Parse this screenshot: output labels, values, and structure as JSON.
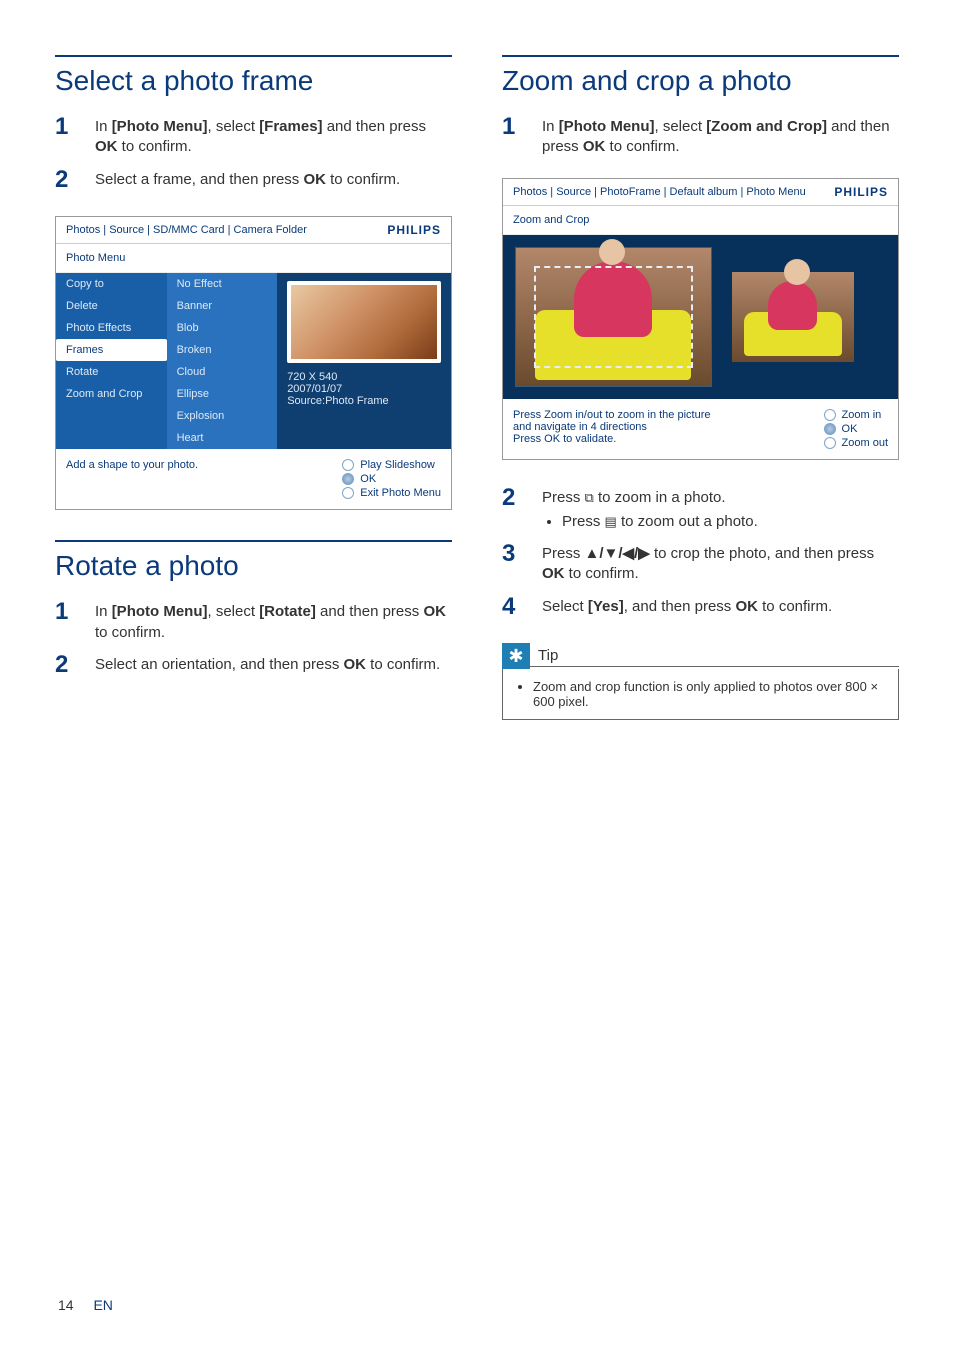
{
  "left": {
    "sec1": {
      "title": "Select a photo frame",
      "steps": [
        "In [Photo Menu], select [Frames] and then press OK to confirm.",
        "Select a frame, and then press OK to confirm."
      ],
      "shot": {
        "breadcrumb": "Photos | Source | SD/MMC Card | Camera Folder",
        "brand": "PHILIPS",
        "subtitle": "Photo Menu",
        "col1": [
          "Copy to",
          "Delete",
          "Photo Effects",
          "Frames",
          "Rotate",
          "Zoom and Crop"
        ],
        "col1_sel": 3,
        "col2": [
          "No Effect",
          "Banner",
          "Blob",
          "Broken",
          "Cloud",
          "Ellipse",
          "Explosion",
          "Heart"
        ],
        "meta": [
          "720 X 540",
          "2007/01/07",
          "Source:Photo Frame"
        ],
        "foot_left": "Add a shape to your photo.",
        "foot_opts": [
          "Play Slideshow",
          "OK",
          "Exit Photo Menu"
        ],
        "foot_sel": 1
      }
    },
    "sec2": {
      "title": "Rotate a photo",
      "steps": [
        "In [Photo Menu], select [Rotate] and then press OK to confirm.",
        "Select an orientation, and then press OK to confirm."
      ]
    }
  },
  "right": {
    "sec1": {
      "title": "Zoom and crop a photo",
      "steps_before": [
        "In [Photo Menu], select [Zoom and Crop] and then press OK to confirm."
      ],
      "shot": {
        "breadcrumb": "Photos | Source | PhotoFrame | Default album | Photo Menu",
        "brand": "PHILIPS",
        "subtitle": "Zoom and Crop",
        "foot_left_lines": [
          "Press Zoom in/out to zoom in the picture",
          "and navigate in 4 directions",
          "Press OK to validate."
        ],
        "foot_opts": [
          "Zoom in",
          "OK",
          "Zoom out"
        ],
        "foot_sel": 1
      },
      "steps_after": [
        {
          "n": "2",
          "t": "Press ⧉ to zoom in a photo.",
          "sub": [
            "Press ▤ to zoom out a photo."
          ]
        },
        {
          "n": "3",
          "t": "Press ▲/▼/◀/▶ to crop the photo, and then press OK to confirm."
        },
        {
          "n": "4",
          "t": "Select [Yes], and then press OK to confirm."
        }
      ],
      "tip": {
        "label": "Tip",
        "text": "Zoom and crop function is only applied to photos over 800 × 600 pixel."
      }
    }
  },
  "footer": {
    "page": "14",
    "lang": "EN"
  }
}
